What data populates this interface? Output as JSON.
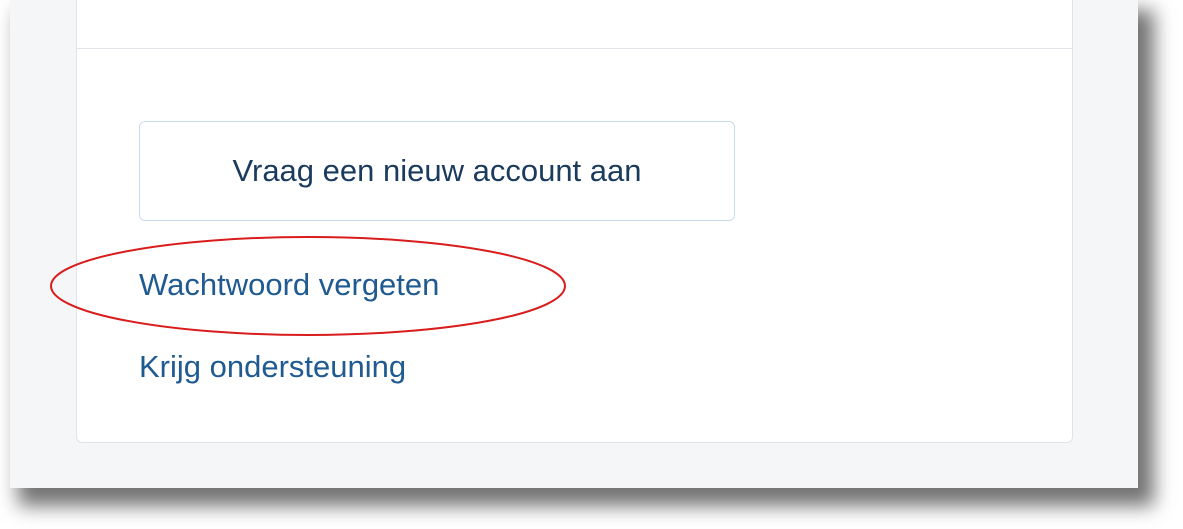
{
  "card": {
    "new_account_label": "Vraag een nieuw account aan",
    "forgot_password_label": "Wachtwoord vergeten",
    "get_support_label": "Krijg ondersteuning"
  },
  "annotation": {
    "color": "#d91c1c",
    "target": "forgot-password-link"
  },
  "colors": {
    "link": "#1f5a91",
    "button_text": "#1a3b5d",
    "button_border": "#c8dcef",
    "card_border": "#e0e3e8"
  }
}
